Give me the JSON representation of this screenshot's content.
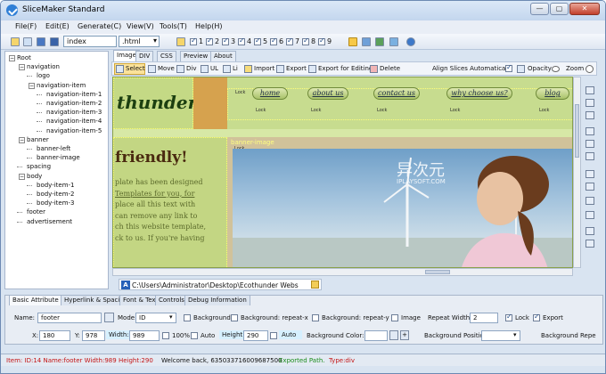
{
  "window": {
    "title": "SliceMaker Standard"
  },
  "menu": [
    "File(F)",
    "Edit(E)",
    "Generate(C)",
    "View(V)",
    "Tools(T)",
    "Help(H)"
  ],
  "toolbar": {
    "filename": "index",
    "extension": ".html",
    "checkboxes": [
      "1",
      "2",
      "3",
      "4",
      "5",
      "6",
      "7",
      "8",
      "9"
    ]
  },
  "tree": {
    "items": [
      {
        "label": "Root",
        "depth": 0
      },
      {
        "label": "navigation",
        "depth": 1
      },
      {
        "label": "logo",
        "depth": 2
      },
      {
        "label": "navigation-item",
        "depth": 2
      },
      {
        "label": "navigation-item-1",
        "depth": 3
      },
      {
        "label": "navigation-item-2",
        "depth": 3
      },
      {
        "label": "navigation-item-3",
        "depth": 3
      },
      {
        "label": "navigation-item-4",
        "depth": 3
      },
      {
        "label": "navigation-item-5",
        "depth": 3
      },
      {
        "label": "banner",
        "depth": 1
      },
      {
        "label": "banner-left",
        "depth": 2
      },
      {
        "label": "banner-image",
        "depth": 2
      },
      {
        "label": "spacing",
        "depth": 1
      },
      {
        "label": "body",
        "depth": 1
      },
      {
        "label": "body-item-1",
        "depth": 2
      },
      {
        "label": "body-item-2",
        "depth": 2
      },
      {
        "label": "body-item-3",
        "depth": 2
      },
      {
        "label": "footer",
        "depth": 1
      },
      {
        "label": "advertisement",
        "depth": 1
      }
    ]
  },
  "tabs": [
    "Image",
    "DIV",
    "CSS",
    "Preview",
    "About"
  ],
  "edit_tools": {
    "select": "Select",
    "move": "Move",
    "div": "Div",
    "ul": "UL",
    "li": "Li",
    "import": "Import",
    "export": "Export",
    "export_editing": "Export for Editing",
    "delete": "Delete",
    "align": "Align Slices Automatically",
    "opacity": "Opacity",
    "zoom": "Zoom"
  },
  "canvas": {
    "logo": "thunder",
    "nav_buttons": [
      "home",
      "about us",
      "contact us",
      "why choose us?",
      "blog"
    ],
    "lock": "Lock",
    "banner_label": "banner-image",
    "heading": "friendly!",
    "copy": [
      "plate has been designed",
      "Templates for you, for",
      "place all this text with",
      "can remove any link to",
      "ch this website template,",
      "ck to us. If you're having"
    ],
    "watermark_cn": "异次元",
    "watermark_en": "IPLAYSOFT.COM"
  },
  "path": "C:\\Users\\Administrator\\Desktop\\Ecothunder Webs",
  "bottom_tabs": [
    "Basic Attribute",
    "Hyperlink & Spacing",
    "Font & Text",
    "Controls",
    "Debug Information"
  ],
  "attributes": {
    "name_label": "Name:",
    "name_value": "footer",
    "mode_label": "Mode:",
    "mode_value": "ID",
    "background": "Background",
    "bg_repeat_x": "Background: repeat-x",
    "bg_repeat_y": "Background: repeat-y",
    "image": "Image",
    "repeat_width_label": "Repeat Width:",
    "repeat_width_value": "2",
    "lock": "Lock",
    "export": "Export",
    "x_label": "X:",
    "x_value": "180",
    "y_label": "Y:",
    "y_value": "978",
    "width_label": "Width:",
    "width_value": "989",
    "percent": "100%",
    "auto": "Auto",
    "height_label": "Height:",
    "height_value": "290",
    "auto2": "Auto",
    "bg_color": "Background Color:",
    "bg_position": "Background Position:",
    "bg_repeat": "Background Repe"
  },
  "status": {
    "item": "Item: ID:14 Name:footer Width:989 Height:290",
    "welcome": "Welcome back, 635033716009687500",
    "exported": "Exported Path.",
    "type": "Type:div"
  },
  "colors": {
    "status_red": "#c41414",
    "status_green": "#1b8c1b",
    "canvas_bg": "#bcd27a",
    "accent": "#2f7fd6"
  }
}
